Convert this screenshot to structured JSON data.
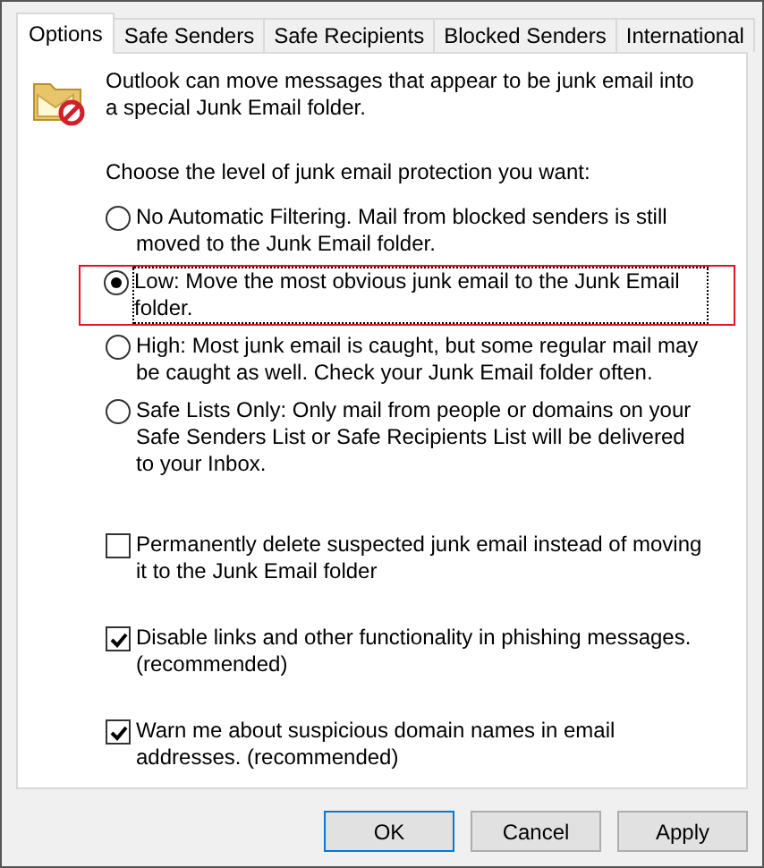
{
  "tabs": [
    {
      "label": "Options",
      "selected": true
    },
    {
      "label": "Safe Senders",
      "selected": false
    },
    {
      "label": "Safe Recipients",
      "selected": false
    },
    {
      "label": "Blocked Senders",
      "selected": false
    },
    {
      "label": "International",
      "selected": false
    }
  ],
  "intro": "Outlook can move messages that appear to be junk email into a special Junk Email folder.",
  "prompt": "Choose the level of junk email protection you want:",
  "levels": [
    {
      "label": "No Automatic Filtering. Mail from blocked senders is still moved to the Junk Email folder.",
      "selected": false,
      "highlighted": false
    },
    {
      "label": "Low: Move the most obvious junk email to the Junk Email folder.",
      "selected": true,
      "highlighted": true
    },
    {
      "label": "High: Most junk email is caught, but some regular mail may be caught as well. Check your Junk Email folder often.",
      "selected": false,
      "highlighted": false
    },
    {
      "label": "Safe Lists Only: Only mail from people or domains on your Safe Senders List or Safe Recipients List will be delivered to your Inbox.",
      "selected": false,
      "highlighted": false
    }
  ],
  "options": [
    {
      "label": "Permanently delete suspected junk email instead of moving it to the Junk Email folder",
      "checked": false
    },
    {
      "label": "Disable links and other functionality in phishing messages. (recommended)",
      "checked": true
    },
    {
      "label": "Warn me about suspicious domain names in email addresses. (recommended)",
      "checked": true
    }
  ],
  "buttons": [
    {
      "label": "OK",
      "kind": "default"
    },
    {
      "label": "Cancel",
      "kind": "normal"
    },
    {
      "label": "Apply",
      "kind": "normal"
    }
  ]
}
